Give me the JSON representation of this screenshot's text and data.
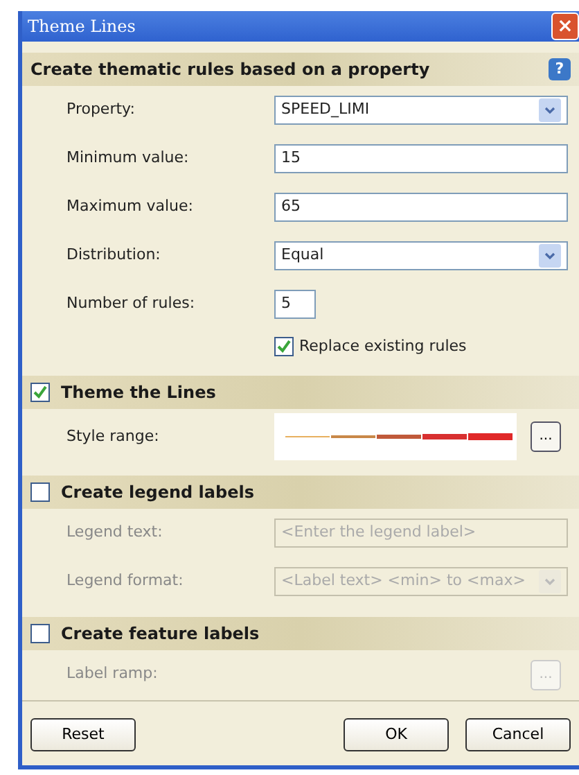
{
  "window": {
    "title": "Theme Lines",
    "close": "×"
  },
  "sections": [
    {
      "kind": "plain",
      "title": "Create thematic rules based on a property",
      "help": "?",
      "rows": [
        {
          "kind": "select",
          "label": "Property:",
          "value": "SPEED_LIMI",
          "disabled": false
        },
        {
          "kind": "text",
          "label": "Minimum value:",
          "value": "15",
          "disabled": false
        },
        {
          "kind": "text",
          "label": "Maximum value:",
          "value": "65",
          "disabled": false
        },
        {
          "kind": "select",
          "label": "Distribution:",
          "value": "Equal",
          "disabled": false
        },
        {
          "kind": "number",
          "label": "Number of rules:",
          "value": "5",
          "disabled": false
        },
        {
          "kind": "check",
          "label": "Replace existing rules",
          "checked": true,
          "disabled": false
        }
      ]
    },
    {
      "kind": "checkable",
      "title": "Theme the Lines",
      "checked": true,
      "rows": [
        {
          "kind": "style",
          "label": "Style range:",
          "button": "...",
          "disabled": false
        }
      ]
    },
    {
      "kind": "checkable",
      "title": "Create legend labels",
      "checked": false,
      "rows": [
        {
          "kind": "text",
          "label": "Legend text:",
          "placeholder": "<Enter the legend label>",
          "disabled": true
        },
        {
          "kind": "select",
          "label": "Legend format:",
          "value": "<Label text> <min> to <max>",
          "disabled": true
        }
      ]
    },
    {
      "kind": "checkable",
      "title": "Create feature labels",
      "checked": false,
      "rows": [
        {
          "kind": "ramp",
          "label": "Label ramp:",
          "button": "...",
          "disabled": true
        }
      ]
    }
  ],
  "buttons": [
    {
      "kind": "left",
      "label": "Reset"
    },
    {
      "kind": "right",
      "label": "OK"
    },
    {
      "kind": "right",
      "label": "Cancel"
    }
  ]
}
